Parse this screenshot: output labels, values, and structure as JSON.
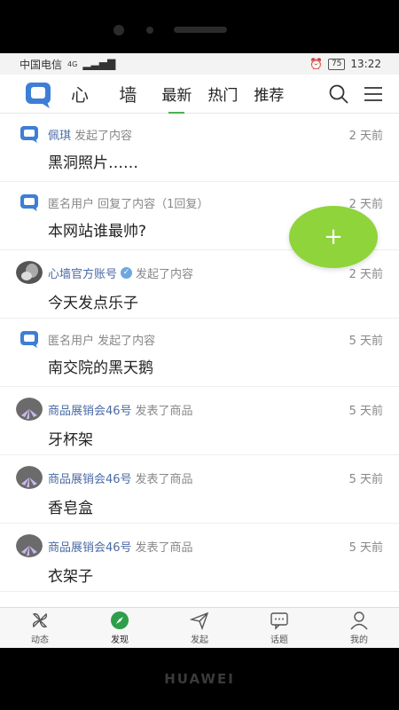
{
  "device": {
    "brand": "HUAWEI"
  },
  "status_bar": {
    "carrier": "中国电信",
    "network": "4G",
    "battery": "75",
    "time": "13:22"
  },
  "app_bar": {
    "title": "心 墙",
    "tabs": [
      {
        "label": "最新",
        "active": true
      },
      {
        "label": "热门",
        "active": false
      },
      {
        "label": "推荐",
        "active": false
      }
    ]
  },
  "feed": [
    {
      "user": "佩琪",
      "verified": false,
      "action": "发起了内容",
      "time": "2 天前",
      "title": "黑洞照片……",
      "avatar": "app-logo"
    },
    {
      "user": "",
      "verified": false,
      "action": "匿名用户 回复了内容（1回复）",
      "time": "2 天前",
      "title": "本网站谁最帅?",
      "avatar": "app-logo"
    },
    {
      "user": "心墙官方账号",
      "verified": true,
      "action": "发起了内容",
      "time": "2 天前",
      "title": "今天发点乐子",
      "avatar": "photo"
    },
    {
      "user": "",
      "verified": false,
      "action": "匿名用户 发起了内容",
      "time": "5 天前",
      "title": "南交院的黑天鹅",
      "avatar": "app-logo"
    },
    {
      "user": "商品展销会46号",
      "verified": false,
      "action": "发表了商品",
      "time": "5 天前",
      "title": "牙杯架",
      "avatar": "pinwheel"
    },
    {
      "user": "商品展销会46号",
      "verified": false,
      "action": "发表了商品",
      "time": "5 天前",
      "title": "香皂盒",
      "avatar": "pinwheel"
    },
    {
      "user": "商品展销会46号",
      "verified": false,
      "action": "发表了商品",
      "time": "5 天前",
      "title": "衣架子",
      "avatar": "pinwheel"
    }
  ],
  "fab": {
    "label": "+"
  },
  "bottom_nav": [
    {
      "label": "动态",
      "icon": "pinwheel-icon",
      "active": false
    },
    {
      "label": "发现",
      "icon": "compass-icon",
      "active": true
    },
    {
      "label": "发起",
      "icon": "send-icon",
      "active": false
    },
    {
      "label": "话题",
      "icon": "chat-icon",
      "active": false
    },
    {
      "label": "我的",
      "icon": "user-icon",
      "active": false
    }
  ],
  "colors": {
    "accent": "#4caf50",
    "fab": "#8fd43a",
    "link": "#4a6aa5",
    "logo": "#3d7fd4"
  }
}
